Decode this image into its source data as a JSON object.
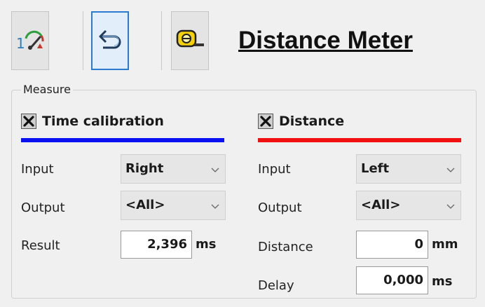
{
  "toolbar": {
    "calibrate_icon": "gauge-calibrate-icon",
    "undo_icon": "undo-arrow-icon",
    "meter_icon": "tape-measure-icon",
    "title": "Distance Meter"
  },
  "measure": {
    "group_label": "Measure",
    "time_calibration": {
      "title": "Time calibration",
      "enabled": true,
      "accent": "#0a10f0",
      "input_label": "Input",
      "input_value": "Right",
      "output_label": "Output",
      "output_value": "<All>",
      "result_label": "Result",
      "result_value": "2,396",
      "result_unit": "ms"
    },
    "distance": {
      "title": "Distance",
      "enabled": true,
      "accent": "#f01010",
      "input_label": "Input",
      "input_value": "Left",
      "output_label": "Output",
      "output_value": "<All>",
      "distance_label": "Distance",
      "distance_value": "0",
      "distance_unit": "mm",
      "delay_label": "Delay",
      "delay_value": "0,000",
      "delay_unit": "ms"
    }
  }
}
